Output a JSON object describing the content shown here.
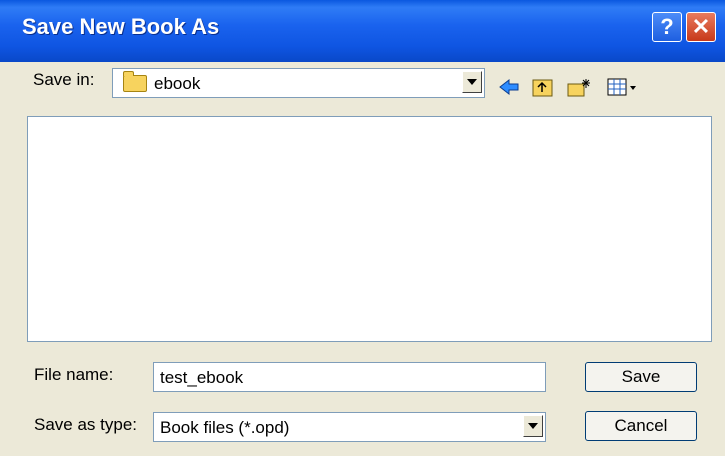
{
  "window": {
    "title": "Save New Book As",
    "help_label": "?",
    "close_label": "✕"
  },
  "save_in": {
    "label": "Save in:",
    "value": "ebook",
    "folder_icon": "folder-icon"
  },
  "toolbar": {
    "back_icon": "back-arrow-icon",
    "up_icon": "up-folder-icon",
    "new_folder_icon": "new-folder-icon",
    "view_icon": "view-menu-icon"
  },
  "file_name": {
    "label": "File name:",
    "value": "test_ebook"
  },
  "save_as_type": {
    "label": "Save as type:",
    "value": "Book files (*.opd)"
  },
  "buttons": {
    "save": "Save",
    "cancel": "Cancel"
  },
  "colors": {
    "title_bar": "#1a63ee",
    "dialog_bg": "#ece9d8",
    "close": "#c7391a"
  }
}
